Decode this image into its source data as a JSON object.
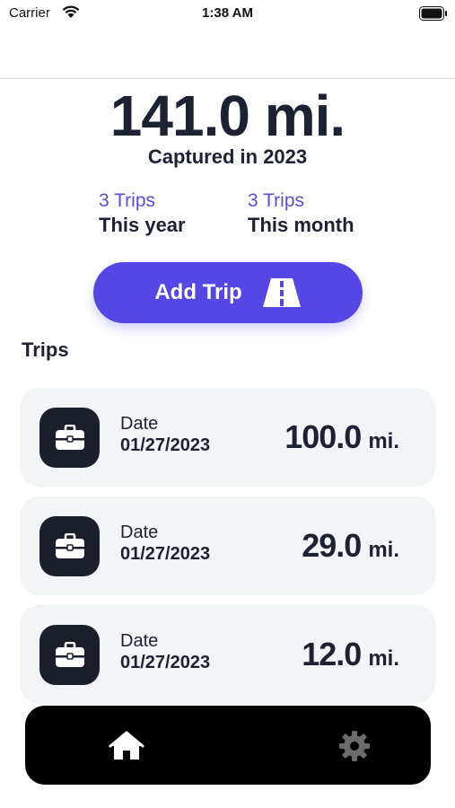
{
  "status_bar": {
    "carrier": "Carrier",
    "time": "1:38 AM"
  },
  "summary": {
    "total_distance": "141.0 mi.",
    "caption": "Captured in 2023",
    "year": {
      "count": "3 Trips",
      "label": "This year"
    },
    "month": {
      "count": "3 Trips",
      "label": "This month"
    }
  },
  "add_trip": {
    "label": "Add Trip",
    "icon": "road-icon"
  },
  "trips_section": {
    "title": "Trips",
    "items": [
      {
        "date_label": "Date",
        "date": "01/27/2023",
        "value": "100.0",
        "unit": "mi.",
        "icon": "briefcase-icon"
      },
      {
        "date_label": "Date",
        "date": "01/27/2023",
        "value": "29.0",
        "unit": "mi.",
        "icon": "briefcase-icon"
      },
      {
        "date_label": "Date",
        "date": "01/27/2023",
        "value": "12.0",
        "unit": "mi.",
        "icon": "briefcase-icon"
      }
    ]
  },
  "tab_bar": {
    "tabs": [
      {
        "icon": "home-icon",
        "active": true
      },
      {
        "icon": "gear-icon",
        "active": false
      }
    ]
  },
  "colors": {
    "accent": "#5546e5",
    "accent_text": "#5a4bdc",
    "dark": "#1c2233",
    "card_bg": "#f3f4f6",
    "icon_bg": "#1a1e2d",
    "tab_bar_bg": "#000000",
    "tab_inactive": "#6b6b6b"
  }
}
